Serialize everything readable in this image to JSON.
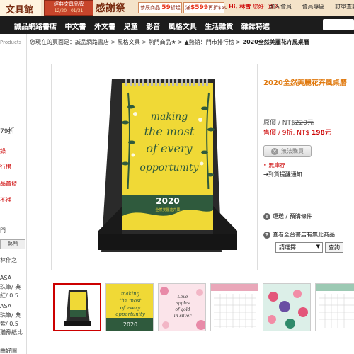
{
  "banner": {
    "logo": "文具館",
    "tag_main": "經典文具品牌",
    "tag_sub": "12/20 - 01/31",
    "thanks": "感謝祭",
    "promo1_label": "參展商品",
    "promo1_value": "59",
    "promo1_unit": "折起",
    "promo2_label": "滿",
    "promo2_value": "$599",
    "promo2_unit": "再折$50",
    "greeting_user": "Hi, 林雪",
    "greeting_rest": " 您好! 登入",
    "links": [
      "加入會員",
      "會員專區",
      "訂單查詢"
    ]
  },
  "nav": {
    "items": [
      "誠品網路書店",
      "中文書",
      "外文書",
      "兒童",
      "影音",
      "風格文具",
      "生活雜貨",
      "雜誌特選"
    ]
  },
  "sidebar": {
    "products": "Products",
    "discount": "79折",
    "lines": [
      "錄",
      "行榜",
      "品首發",
      "不補"
    ],
    "tab": "熱門",
    "section": "門",
    "list": [
      "林作之",
      "ASA",
      "珠筆/ 典",
      "紅/ 0.5",
      "ASA",
      "珠筆/ 典",
      "紫/ 0.5",
      "猶豫紙比",
      "曲好圖"
    ]
  },
  "breadcrumb": {
    "prefix": "您現在的頁面是：",
    "items": [
      "誠品網路書店",
      "風格文具",
      "熱門商品★",
      "▲熱銷！門市排行榜"
    ],
    "current": "2020全然美麗花卉風桌曆"
  },
  "product": {
    "title": "2020全然美麗花卉風桌曆",
    "orig_label": "原價 / NT$",
    "orig_price": "220元",
    "sale_label": "售價 / 9折, NT$ ",
    "sale_price": "198元",
    "buy_button": "無法購買",
    "stock": "無庫存",
    "notify": "→到貨提醒通知",
    "shipping": "運送 / 預購條件",
    "store_check": "查看全台書店有無此商品",
    "select_value": "請選擇",
    "query_button": "查詢"
  },
  "calendar_image": {
    "text_lines": [
      "making",
      "the most",
      "of every",
      "opportunity"
    ],
    "year": "2020",
    "subtitle": "全然美麗花卉風"
  },
  "thumbnails": [
    {
      "type": "desk"
    },
    {
      "type": "yellow",
      "text": "making the most of every opportunity"
    },
    {
      "type": "pink",
      "text": "Love apples of gold in settings of silver"
    },
    {
      "type": "grid"
    },
    {
      "type": "flower-grid"
    },
    {
      "type": "grid"
    }
  ],
  "colors": {
    "accent": "#e07a10",
    "price_red": "#c00000",
    "nav_bg": "#1c1c1c",
    "calendar_yellow": "#f0d936",
    "calendar_green": "#2f5a3d"
  }
}
